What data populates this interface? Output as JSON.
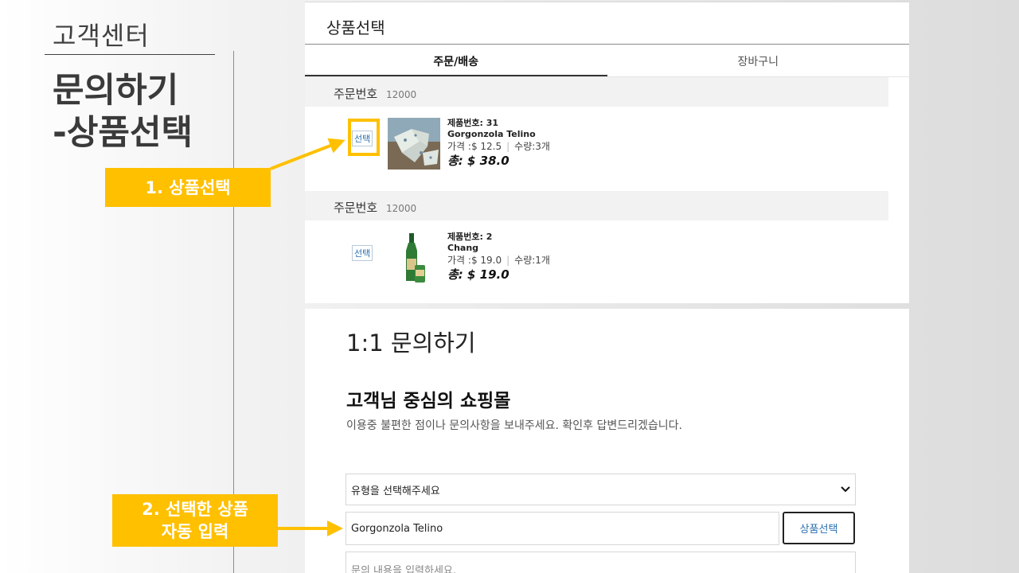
{
  "slide": {
    "subtitle": "고객센터",
    "title": "문의하기\n-상품선택",
    "callouts": {
      "step1": "1. 상품선택",
      "step2": "2. 선택한 상품\n자동 입력"
    },
    "accent_color": "#ffc000"
  },
  "product_panel": {
    "header": "상품선택",
    "tabs": [
      {
        "label": "주문/배송",
        "active": true
      },
      {
        "label": "장바구니",
        "active": false
      }
    ],
    "orders": [
      {
        "label": "주문번호",
        "number": "12000",
        "select_label": "선택",
        "product_id": "제품번호: 31",
        "product_name": "Gorgonzola Telino",
        "price": "가격 :$ 12.5",
        "quantity": "수량:3개",
        "total": "총: $ 38.0",
        "image_icon": "cheese-image"
      },
      {
        "label": "주문번호",
        "number": "12000",
        "select_label": "선택",
        "product_id": "제품번호: 2",
        "product_name": "Chang",
        "price": "가격 :$ 19.0",
        "quantity": "수량:1개",
        "total": "총: $ 19.0",
        "image_icon": "beer-image"
      }
    ]
  },
  "inquiry": {
    "title": "1:1 문의하기",
    "subtitle": "고객님 중심의 쇼핑몰",
    "description": "이용중 불편한 점이나 문의사항을 보내주세요. 확인후 답변드리겠습니다.",
    "type_select": {
      "value": "유형을 선택해주세요",
      "icon": "chevron-down-icon"
    },
    "product_field": {
      "value": "Gorgonzola Telino"
    },
    "product_select_button": "상품선택",
    "content_field": {
      "placeholder": "문의 내용을 입력하세요."
    }
  }
}
